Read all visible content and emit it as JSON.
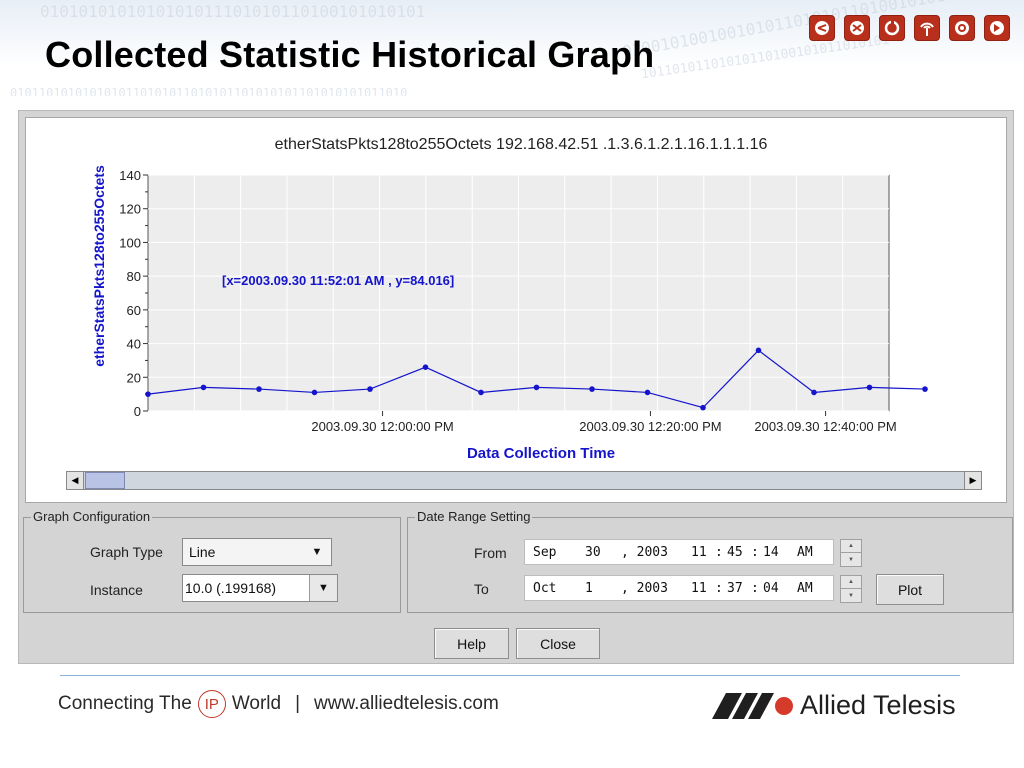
{
  "slide": {
    "title": "Collected Statistic Historical Graph",
    "header_icons": [
      "share-icon",
      "shuffle-icon",
      "refresh-icon",
      "broadcast-icon",
      "target-icon",
      "forward-icon"
    ],
    "brand_color": "#b82f1c"
  },
  "chart_data": {
    "type": "line",
    "title": "etherStatsPkts128to255Octets 192.168.42.51 .1.3.6.1.2.1.16.1.1.1.16",
    "xlabel": "Data Collection Time",
    "ylabel": "etherStatsPkts128to255Octets",
    "ylim": [
      0,
      140
    ],
    "yticks": [
      "0",
      "20",
      "40",
      "60",
      "80",
      "100",
      "120",
      "140"
    ],
    "xticks": [
      "2003.09.30 12:00:00 PM",
      "2003.09.30 12:20:00 PM",
      "2003.09.30 12:40:00 PM"
    ],
    "grid": true,
    "annotation": "[x=2003.09.30 11:52:01 AM , y=84.016]",
    "series": [
      {
        "values": [
          10,
          14,
          13,
          11,
          13,
          26,
          11,
          14,
          13,
          11,
          2,
          36,
          11,
          14,
          13
        ]
      }
    ],
    "line_color": "#1414cc"
  },
  "graph_config": {
    "group_title": "Graph Configuration",
    "graph_type_label": "Graph Type",
    "graph_type_value": "Line",
    "instance_label": "Instance",
    "instance_value": "10.0  (.199168)"
  },
  "date_range": {
    "group_title": "Date Range Setting",
    "from_label": "From",
    "from": {
      "month": "Sep",
      "day": "30",
      "year": ", 2003",
      "hour": "11",
      "minute": "45",
      "second": "14",
      "ampm": "AM"
    },
    "to_label": "To",
    "to": {
      "month": "Oct",
      "day": "1",
      "year": ", 2003",
      "hour": "11",
      "minute": "37",
      "second": "04",
      "ampm": "AM"
    },
    "plot_label": "Plot"
  },
  "buttons": {
    "help": "Help",
    "close": "Close"
  },
  "footer": {
    "tagline_pre": "Connecting The",
    "tagline_ip": "IP",
    "tagline_post": "World",
    "separator": "|",
    "url": "www.alliedtelesis.com",
    "logo_text": "Allied Telesis"
  }
}
